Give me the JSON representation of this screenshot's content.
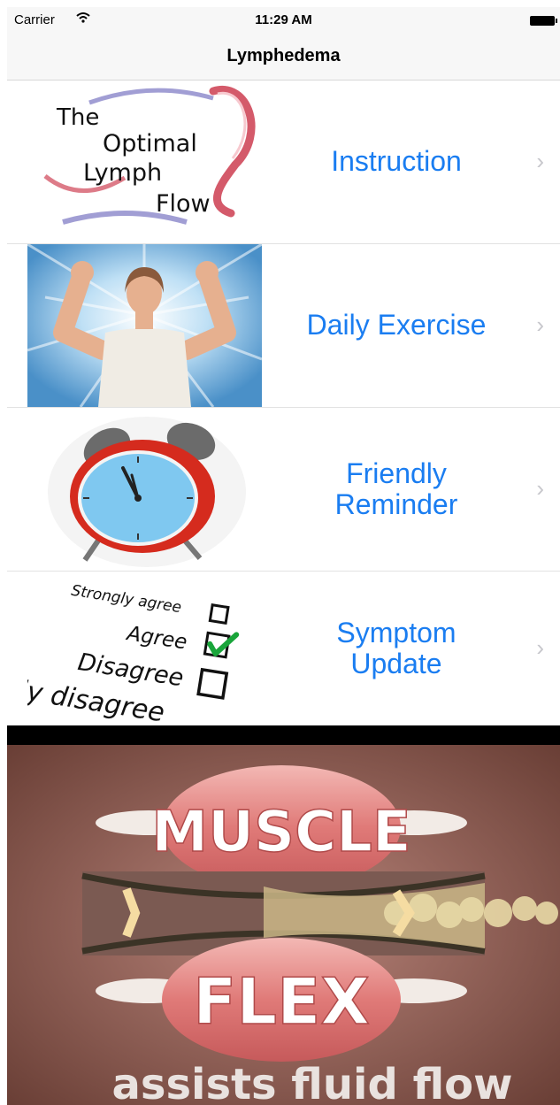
{
  "status_bar": {
    "carrier": "Carrier",
    "time": "11:29 AM"
  },
  "navbar": {
    "title": "Lymphedema"
  },
  "menu": [
    {
      "label": "Instruction",
      "image_text": [
        "The",
        "Optimal",
        "Lymph",
        "Flow"
      ]
    },
    {
      "label": "Daily Exercise"
    },
    {
      "label": "Friendly\nReminder"
    },
    {
      "label": "Symptom\nUpdate",
      "image_text": [
        "Strongly agree",
        "Agree",
        "Disagree",
        "ly disagree"
      ]
    }
  ],
  "chevron": "›",
  "banner": {
    "word1": "MUSCLE",
    "word2": "FLEX",
    "caption": "assists fluid flow"
  },
  "colors": {
    "accent": "#1a7df1",
    "chevron": "#c7c7cc",
    "banner_bg": "#7a4a3f"
  }
}
